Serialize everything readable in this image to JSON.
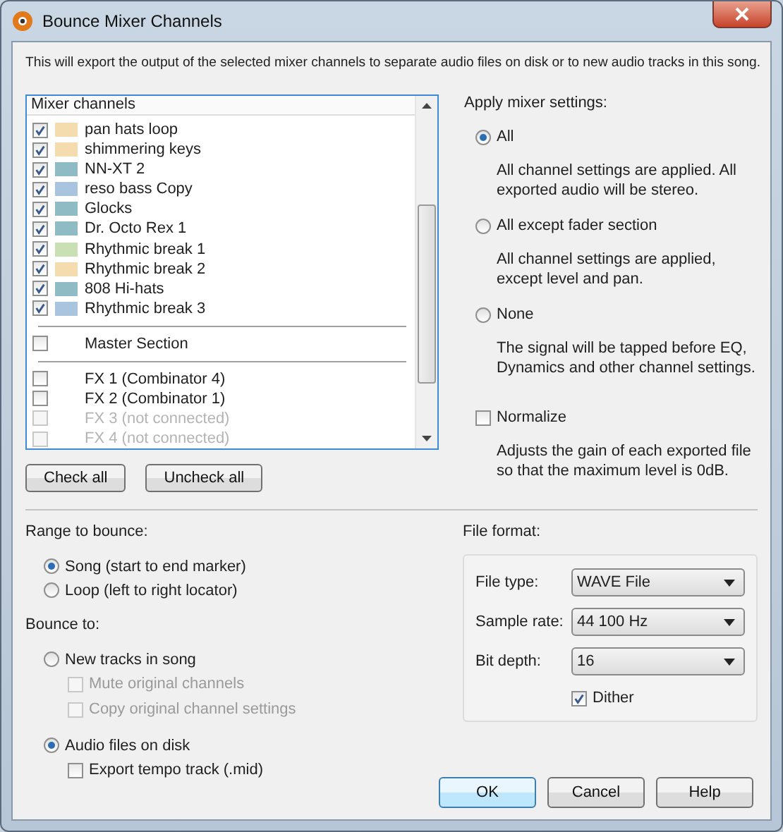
{
  "window": {
    "title": "Bounce Mixer Channels"
  },
  "intro": "This will export the output of the selected mixer channels to separate audio files on disk or to new audio tracks in this song.",
  "mixer_channels": {
    "header": "Mixer channels",
    "groups": [
      {
        "items": [
          {
            "name": "pan hats loop",
            "checked": true,
            "disabled": false,
            "color": "#f5dcae"
          },
          {
            "name": "shimmering keys",
            "checked": true,
            "disabled": false,
            "color": "#f5dcae"
          },
          {
            "name": "NN-XT 2",
            "checked": true,
            "disabled": false,
            "color": "#8fbcc4"
          },
          {
            "name": "reso bass Copy",
            "checked": true,
            "disabled": false,
            "color": "#a9c4de"
          },
          {
            "name": "Glocks",
            "checked": true,
            "disabled": false,
            "color": "#8fbcc4"
          },
          {
            "name": "Dr. Octo Rex 1",
            "checked": true,
            "disabled": false,
            "color": "#8fbcc4"
          },
          {
            "name": "Rhythmic break 1",
            "checked": true,
            "disabled": false,
            "color": "#c9dfb4"
          },
          {
            "name": "Rhythmic break 2",
            "checked": true,
            "disabled": false,
            "color": "#f5dcae"
          },
          {
            "name": "808 Hi-hats",
            "checked": true,
            "disabled": false,
            "color": "#8fbcc4"
          },
          {
            "name": "Rhythmic break 3",
            "checked": true,
            "disabled": false,
            "color": "#a9c4de"
          }
        ]
      },
      {
        "items": [
          {
            "name": "Master Section",
            "checked": false,
            "disabled": false
          }
        ]
      },
      {
        "items": [
          {
            "name": "FX 1 (Combinator 4)",
            "checked": false,
            "disabled": false
          },
          {
            "name": "FX 2 (Combinator 1)",
            "checked": false,
            "disabled": false
          },
          {
            "name": "FX 3 (not connected)",
            "checked": false,
            "disabled": true
          },
          {
            "name": "FX 4 (not connected)",
            "checked": false,
            "disabled": true
          }
        ]
      }
    ]
  },
  "list_buttons": [
    "Check all",
    "Uncheck all"
  ],
  "apply_settings": {
    "label": "Apply mixer settings:",
    "options": [
      {
        "label": "All",
        "selected": true,
        "description": "All channel settings are applied. All exported audio will be stereo."
      },
      {
        "label": "All except fader section",
        "selected": false,
        "description": "All channel settings are applied, except level and pan."
      },
      {
        "label": "None",
        "selected": false,
        "description": "The signal will be tapped before EQ, Dynamics and other channel settings."
      }
    ],
    "normalize": {
      "label": "Normalize",
      "checked": false,
      "description": "Adjusts the gain of each exported file so that the maximum level is 0dB."
    }
  },
  "range": {
    "label": "Range to bounce:",
    "options": [
      {
        "label": "Song (start to end marker)",
        "selected": true
      },
      {
        "label": "Loop (left to right locator)",
        "selected": false
      }
    ]
  },
  "bounce_to": {
    "label": "Bounce to:",
    "options": [
      {
        "label": "New tracks in song",
        "selected": false,
        "suboptions": [
          {
            "label": "Mute original channels",
            "checked": false,
            "disabled": true
          },
          {
            "label": "Copy original channel settings",
            "checked": false,
            "disabled": true
          }
        ]
      },
      {
        "label": "Audio files on disk",
        "selected": true,
        "suboptions": [
          {
            "label": "Export tempo track (.mid)",
            "checked": false,
            "disabled": false
          }
        ]
      }
    ]
  },
  "file_format": {
    "label": "File format:",
    "fields": [
      {
        "label": "File type:",
        "value": "WAVE File"
      },
      {
        "label": "Sample rate:",
        "value": "44 100 Hz"
      },
      {
        "label": "Bit depth:",
        "value": "16"
      }
    ],
    "dither": {
      "label": "Dither",
      "checked": true
    }
  },
  "buttons": [
    {
      "label": "OK",
      "default": true
    },
    {
      "label": "Cancel",
      "default": false
    },
    {
      "label": "Help",
      "default": false
    }
  ]
}
